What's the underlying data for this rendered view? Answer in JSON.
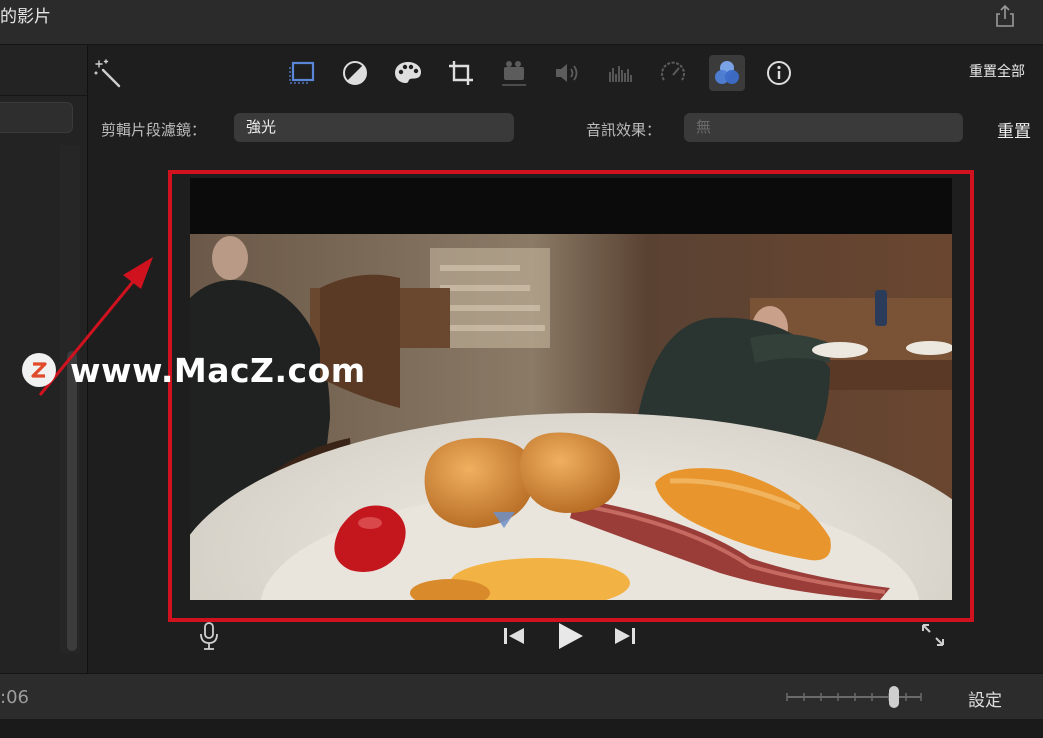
{
  "window": {
    "title": "的影片"
  },
  "toolbar": {
    "tools": [
      "magic-wand",
      "crop-to-fill",
      "color-balance",
      "color-correction",
      "crop",
      "stabilization",
      "volume",
      "noise-reduction-equalizer",
      "speed",
      "clip-filter",
      "info"
    ],
    "active_tool": "clip-filter",
    "reset_all_label": "重置全部"
  },
  "filter_row": {
    "clip_filter_label": "剪輯片段濾鏡：",
    "clip_filter_value": "強光",
    "audio_effect_label": "音訊效果：",
    "audio_effect_value": "無",
    "reset_label": "重置"
  },
  "watermark": {
    "badge": "Z",
    "text": "www.MacZ.com"
  },
  "colors": {
    "highlight": "#d0121f",
    "accent": "#5a86d8"
  },
  "playback": {
    "buttons": [
      "mic-icon",
      "skip-back-icon",
      "play-icon",
      "skip-forward-icon",
      "fullscreen-icon"
    ]
  },
  "bottom_bar": {
    "timecode": ":06",
    "settings_label": "設定"
  }
}
